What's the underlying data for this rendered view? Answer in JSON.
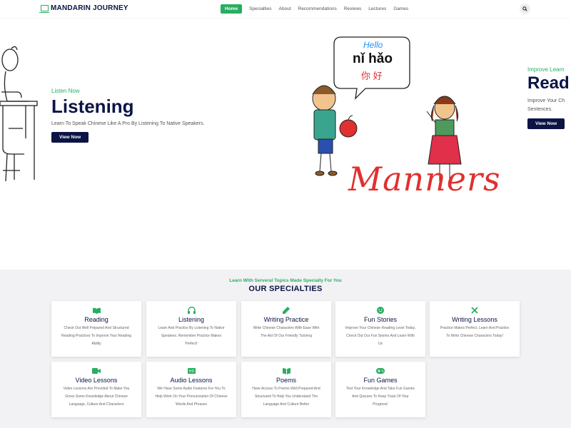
{
  "header": {
    "logo": "MANDARIN JOURNEY",
    "nav": [
      "Home",
      "Specialties",
      "About",
      "Recommendations",
      "Reviews",
      "Lectures",
      "Games"
    ]
  },
  "hero": {
    "left": {
      "subtitle": "Listen Now",
      "title": "Listening",
      "description": "Learn To Speak Chinese Like A Pro By Listening To Native Speakers.",
      "button": "View Now"
    },
    "center_image": {
      "bubble_hello": "Hello",
      "bubble_pinyin": "nǐ hǎo",
      "bubble_hanzi": "你 好",
      "caption": "Manners"
    },
    "right": {
      "subtitle": "Improve Learn",
      "title": "Read",
      "description_line1": "Improve Your Ch",
      "description_line2": "Sentences.",
      "button": "View Now"
    }
  },
  "specialties": {
    "subtitle": "Learn With Serveral Topics Made Specially For You",
    "title": "OUR SPECIALTIES",
    "accent": "#27ae60",
    "cards": [
      {
        "icon": "book-open-icon",
        "title": "Reading",
        "description": "Check Out Well Prepared And Structured Reading Practices To Improve Your Reading Ability"
      },
      {
        "icon": "headphones-icon",
        "title": "Listening",
        "description": "Learn And Practice By Listening To Native Speakers. Remember Practice Makes Perfect!"
      },
      {
        "icon": "pencil-icon",
        "title": "Writing Practice",
        "description": "Write Chinese Characters With Ease With The Aid Of Our Friendly Tutoring"
      },
      {
        "icon": "smile-icon",
        "title": "Fun Stories",
        "description": "Improve Your Chinese Reading Level Today, Check Out Our Fun Stories And Learn With Us"
      },
      {
        "icon": "tools-icon",
        "title": "Writing Lessons",
        "description": "Practice Makes Perfect, Learn And Practice To Write Chinese Characters Today!"
      },
      {
        "icon": "video-icon",
        "title": "Video Lessons",
        "description": "Video Lessons Are Provided To Make You Gross Some Knowledge About Chinese Language, Culture And Characters"
      },
      {
        "icon": "audio-icon",
        "title": "Audio Lessons",
        "description": "We Have Some Audio Features For You To Help Work On Your Pronunciation Of Chinese Words And Phrases"
      },
      {
        "icon": "book-icon",
        "title": "Poems",
        "description": "Have Access To Poems Well Prepared And Structured To Help You Understand The Language And Culture Better"
      },
      {
        "icon": "gamepad-icon",
        "title": "Fun Games",
        "description": "Test Your Knowledge And Take Fun Games And Quizzes To Keep Track Of Your Progress!"
      }
    ]
  }
}
